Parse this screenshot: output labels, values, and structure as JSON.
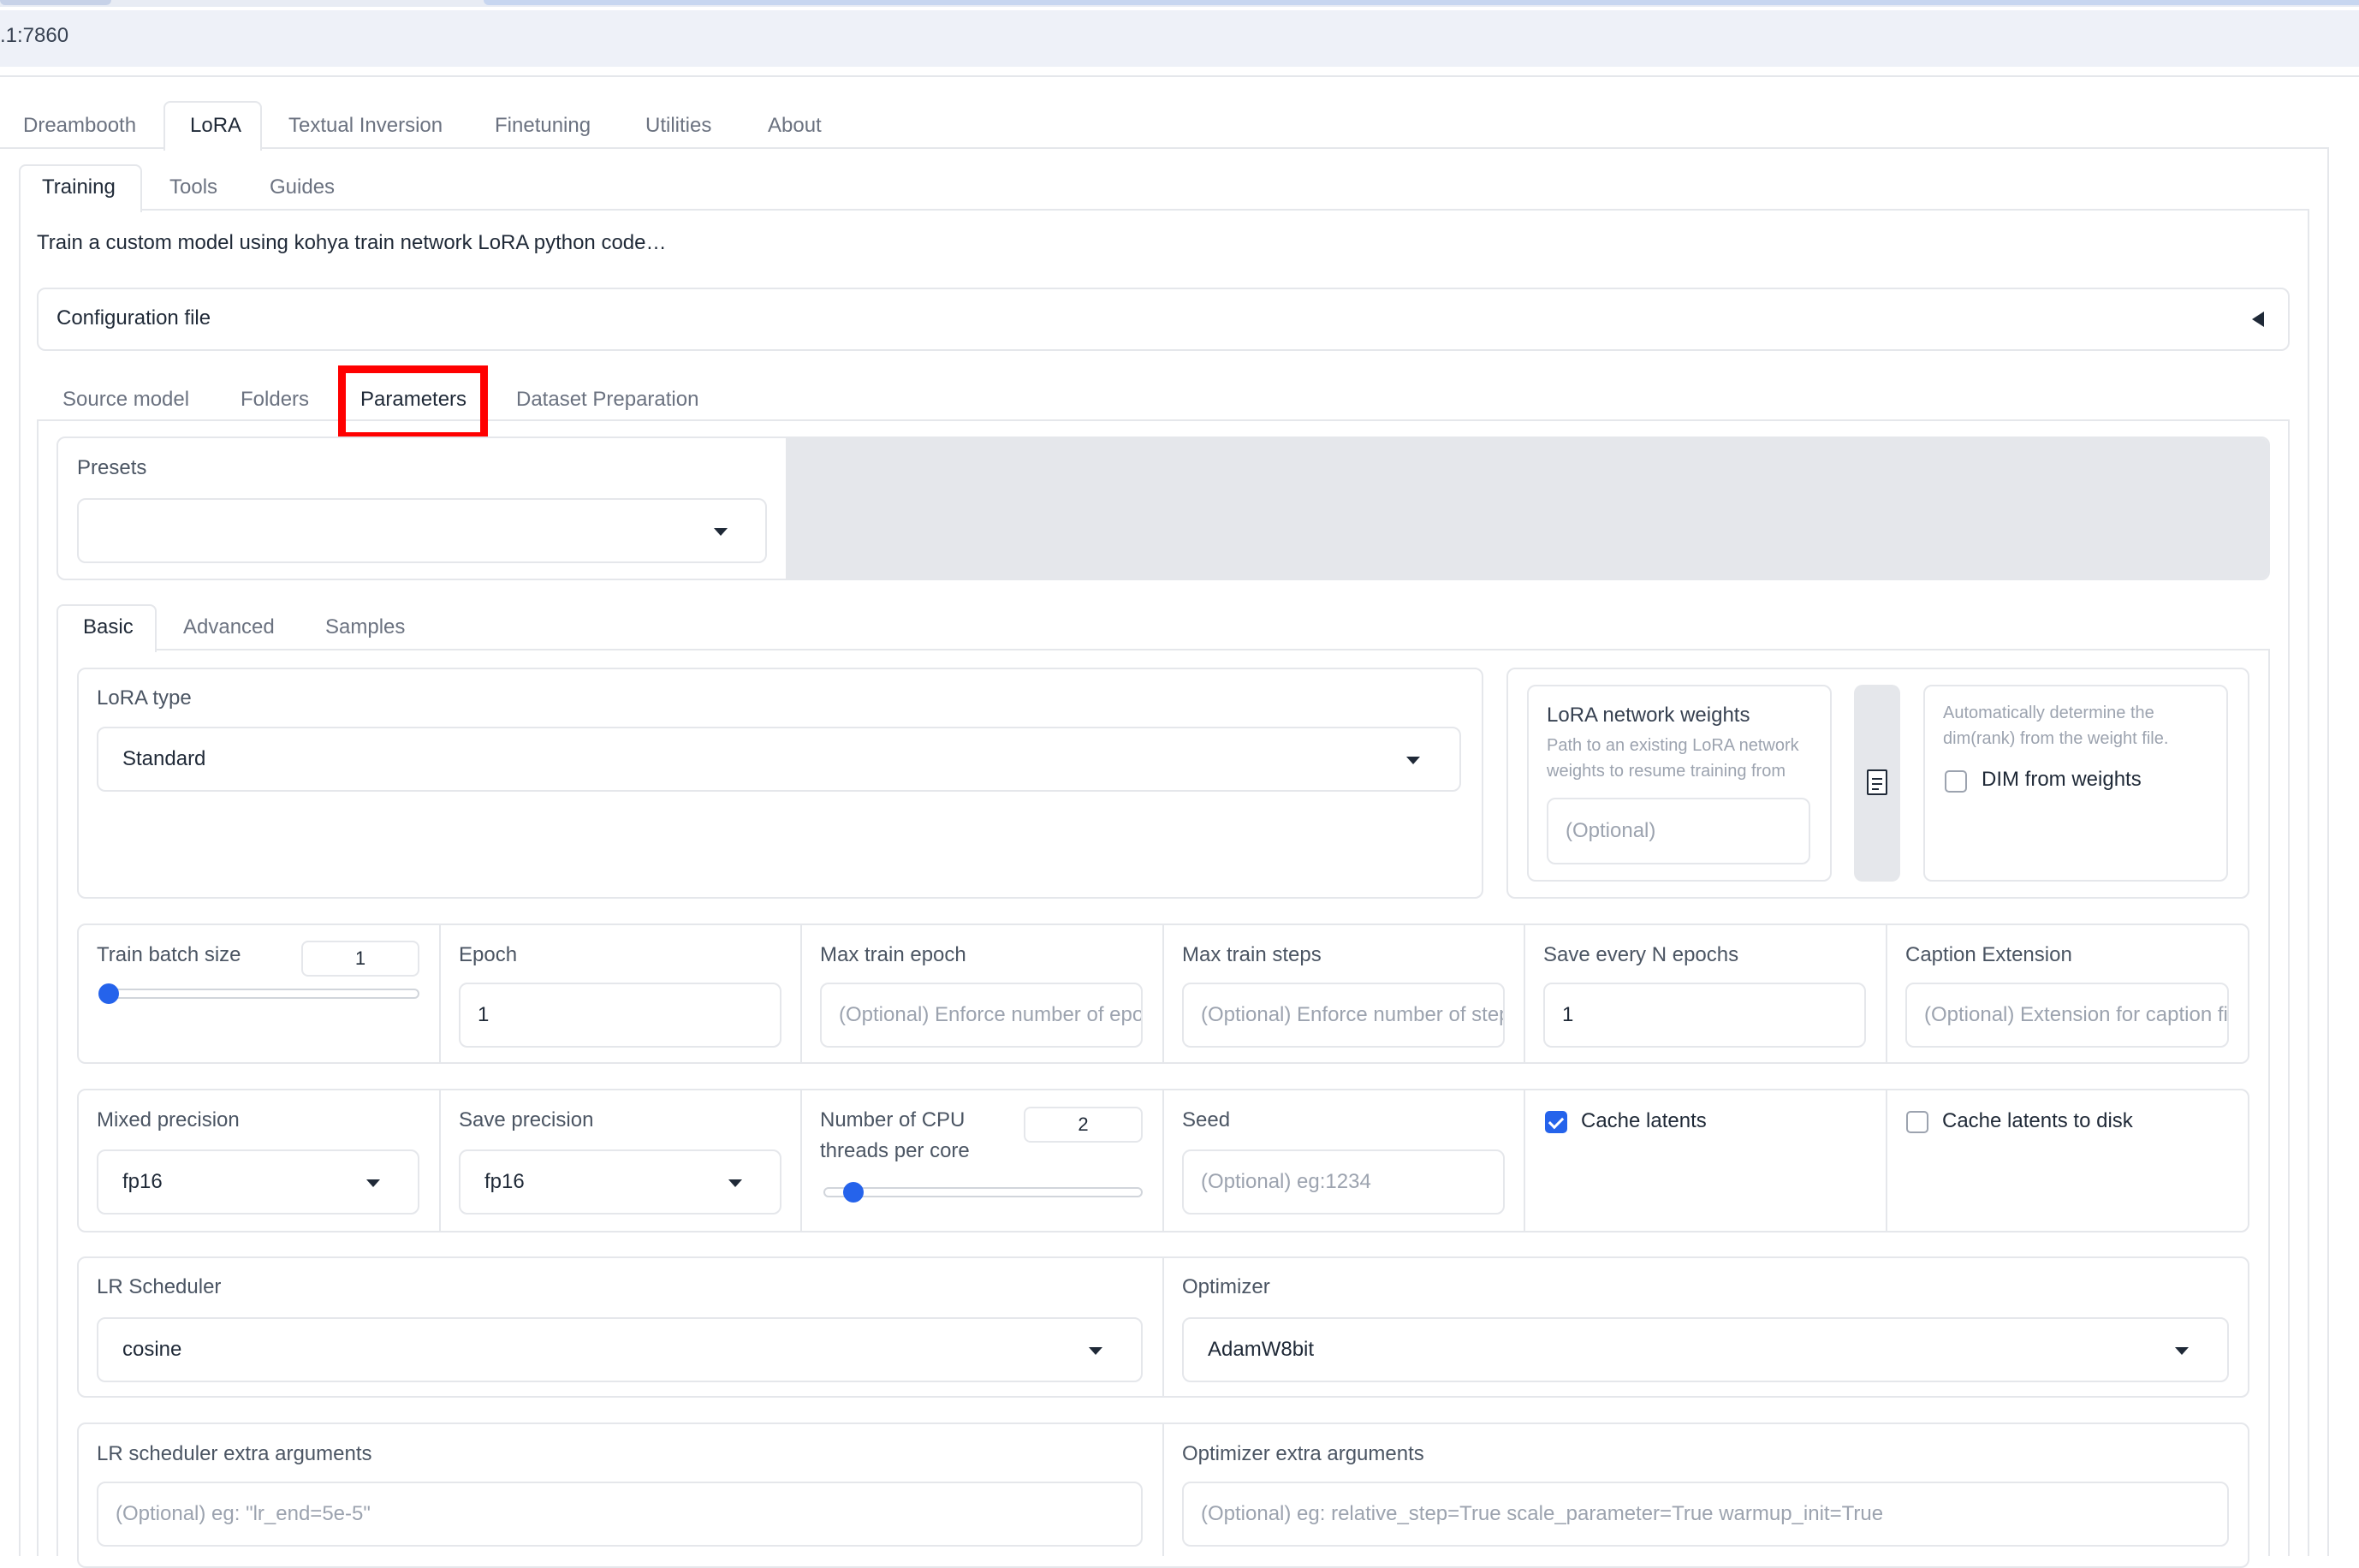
{
  "browser": {
    "url": ".1:7860"
  },
  "top_tabs": [
    "Dreambooth",
    "LoRA",
    "Textual Inversion",
    "Finetuning",
    "Utilities",
    "About"
  ],
  "sub_tabs": [
    "Training",
    "Tools",
    "Guides"
  ],
  "description": "Train a custom model using kohya train network LoRA python code…",
  "config_file": {
    "label": "Configuration file",
    "toggle_icon": "triangle-left-icon"
  },
  "section_tabs": [
    "Source model",
    "Folders",
    "Parameters",
    "Dataset Preparation"
  ],
  "highlight_color": "#ff0000",
  "presets": {
    "label": "Presets",
    "value": ""
  },
  "param_tabs": [
    "Basic",
    "Advanced",
    "Samples"
  ],
  "lora_type": {
    "label": "LoRA type",
    "value": "Standard"
  },
  "network_weights": {
    "label": "LoRA network weights",
    "info": "Path to an existing LoRA network weights to resume training from",
    "placeholder": "(Optional)",
    "file_icon": "document-icon"
  },
  "dim_from_weights": {
    "info": "Automatically determine the dim(rank) from the weight file.",
    "label": "DIM from weights",
    "checked": false
  },
  "train_batch_size": {
    "label": "Train batch size",
    "value": "1",
    "slider_fraction": 0.0
  },
  "epoch": {
    "label": "Epoch",
    "value": "1"
  },
  "max_train_epoch": {
    "label": "Max train epoch",
    "placeholder": "(Optional) Enforce number of epoch"
  },
  "max_train_steps": {
    "label": "Max train steps",
    "placeholder": "(Optional) Enforce number of steps"
  },
  "save_every_n_epochs": {
    "label": "Save every N epochs",
    "value": "1"
  },
  "caption_extension": {
    "label": "Caption Extension",
    "placeholder": "(Optional) Extension for caption files. default: .caption"
  },
  "mixed_precision": {
    "label": "Mixed precision",
    "value": "fp16"
  },
  "save_precision": {
    "label": "Save precision",
    "value": "fp16"
  },
  "cpu_threads": {
    "label_line1": "Number of CPU",
    "label_line2": "threads per core",
    "value": "2",
    "slider_fraction": 0.1
  },
  "seed": {
    "label": "Seed",
    "placeholder": "(Optional) eg:1234"
  },
  "cache_latents": {
    "label": "Cache latents",
    "checked": true
  },
  "cache_latents_to_disk": {
    "label": "Cache latents to disk",
    "checked": false
  },
  "lr_scheduler": {
    "label": "LR Scheduler",
    "value": "cosine"
  },
  "optimizer": {
    "label": "Optimizer",
    "value": "AdamW8bit"
  },
  "lr_scheduler_args": {
    "label": "LR scheduler extra arguments",
    "placeholder": "(Optional) eg: \"lr_end=5e-5\""
  },
  "optimizer_args": {
    "label": "Optimizer extra arguments",
    "placeholder": "(Optional) eg: relative_step=True scale_parameter=True warmup_init=True"
  }
}
